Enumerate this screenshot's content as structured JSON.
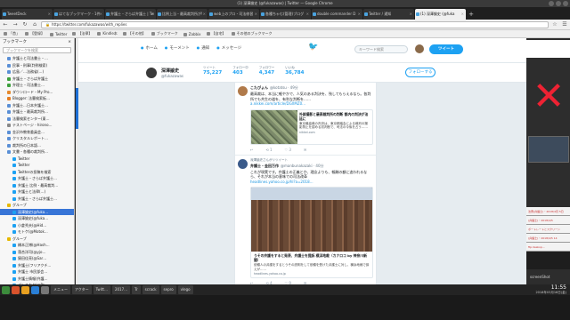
{
  "window": {
    "title": "(1) 深澤諭史 (@fukazawas) | Twitter — Google Chrome"
  },
  "tabs": [
    {
      "label": "TweetDeck",
      "active": false
    },
    {
      "label": "はてなブックマーク - 1件",
      "active": false
    },
    {
      "label": "弁護士・さらば弁護士 | Tw",
      "active": false
    },
    {
      "label": "比例上当・最高裁判所が!",
      "active": false
    },
    {
      "label": "web上のプロ・司法修習",
      "active": false
    },
    {
      "label": "各種ちゃむ(管理)ブログ",
      "active": false
    },
    {
      "label": "double commander D",
      "active": false
    },
    {
      "label": "Twitter / 通知",
      "active": false
    },
    {
      "label": "(1) 深澤諭史 (@fuka",
      "active": true
    }
  ],
  "nav": {
    "url": "https://twitter.com/fukazawas/with_replies",
    "search_placeholder": "検索"
  },
  "bookmarks_bar": [
    "「首」",
    "【登録】",
    "Twitter",
    "【法律】",
    "Kindle本",
    "【その他】",
    "ブックマーク",
    "Zabbix",
    "【自宅】",
    "その他のブックマーク"
  ],
  "sidebar": {
    "title": "ブックマーク",
    "close": "×",
    "search_placeholder": "ブックマークを検索",
    "items": [
      {
        "label": "弁護士と司法書士・…",
        "color": "#5a8fd6",
        "selected": false
      },
      {
        "label": "民事・刑事(判例検索)",
        "color": "#5a8fd6",
        "selected": false
      },
      {
        "label": "広島／…法務省(…)",
        "color": "#5a8fd6",
        "selected": false
      },
      {
        "label": "弁護士・さらば弁護士",
        "color": "#3da03d",
        "selected": false
      },
      {
        "label": "弁理士・司法書士…",
        "color": "#3da03d",
        "selected": false
      },
      {
        "label": "ダウンロード・My Pro…",
        "color": "#e68a2e",
        "selected": false
      },
      {
        "label": "Blogger: 法曹検索板…",
        "color": "#e67e22",
        "selected": false
      },
      {
        "label": "弁護士…日本弁護士…",
        "color": "#5a8fd6",
        "selected": false
      },
      {
        "label": "弁護士・最高裁判所…",
        "color": "#5a8fd6",
        "selected": false
      },
      {
        "label": "法曹検索センター(東…",
        "color": "#5a8fd6",
        "selected": false
      },
      {
        "label": "テストページ - hirono…",
        "color": "#888888",
        "selected": false
      },
      {
        "label": "金沢市教育委員会…",
        "color": "#5a8fd6",
        "selected": false
      },
      {
        "label": "クリスタルレポート…",
        "color": "#5a8fd6",
        "selected": false
      },
      {
        "label": "裁判所の日本語…",
        "color": "#5a8fd6",
        "selected": false
      },
      {
        "label": "文書・各種の裁判所…",
        "color": "#5a8fd6",
        "selected": false
      },
      {
        "label": "Twitter",
        "color": "#1da1f2",
        "selected": false
      },
      {
        "label": "Twitter",
        "color": "#1da1f2",
        "selected": false
      },
      {
        "label": "Twitterの投稿を検索",
        "color": "#1da1f2",
        "selected": false
      },
      {
        "label": "弁護士・さらば弁護士…",
        "color": "#1da1f2",
        "selected": false
      },
      {
        "label": "弁護士 比例・最高裁判…",
        "color": "#1da1f2",
        "selected": false
      },
      {
        "label": "弁護士と法律(…)",
        "color": "#1da1f2",
        "selected": false
      },
      {
        "label": "弁護士・さらば弁護士…",
        "color": "#1da1f2",
        "selected": false
      },
      {
        "label": "グループ",
        "color": "#e6b800",
        "selected": false
      },
      {
        "label": "深澤諭史(@fuka…",
        "color": "#1da1f2",
        "selected": true
      },
      {
        "label": "深澤諭史(@fuka…",
        "color": "#1da1f2",
        "selected": false
      },
      {
        "label": "小倉秀夫(@Hid…",
        "color": "#1da1f2",
        "selected": false
      },
      {
        "label": "モトケ(@Motok…",
        "color": "#1da1f2",
        "selected": false
      },
      {
        "label": "グループ",
        "color": "#e6b800",
        "selected": false
      },
      {
        "label": "橋本正博(@Hash…",
        "color": "#1da1f2",
        "selected": false
      },
      {
        "label": "落合洋司(@yjo…",
        "color": "#1da1f2",
        "selected": false
      },
      {
        "label": "猿田佳亮(@Sar…",
        "color": "#1da1f2",
        "selected": false
      },
      {
        "label": "弁護士(フリアクチ…",
        "color": "#1da1f2",
        "selected": false
      },
      {
        "label": "弁護士 市民部会…",
        "color": "#1da1f2",
        "selected": false
      },
      {
        "label": "弁護士情報(弁護…",
        "color": "#1da1f2",
        "selected": false
      },
      {
        "label": "パレスカタ(@Pa…",
        "color": "#1da1f2",
        "selected": false
      }
    ]
  },
  "twitter_header": {
    "nav_items": [
      "ホーム",
      "モーメント",
      "通知",
      "メッセージ"
    ],
    "search_placeholder": "キーワード検索",
    "tweet_button": "ツイート"
  },
  "profile": {
    "name": "深澤諭史",
    "handle": "@fukazawas",
    "stats": [
      {
        "label": "ツイート",
        "value": "75,227"
      },
      {
        "label": "フォロー中",
        "value": "403"
      },
      {
        "label": "フォロワー",
        "value": "4,347"
      },
      {
        "label": "いいね",
        "value": "36,784"
      }
    ],
    "follow_label": "フォローする"
  },
  "tweets": [
    {
      "retweet_note": "",
      "name": "こたぴょん",
      "handle": "@kotatsu · 49分",
      "text": "最高裁は、本当に軽やかで、人気のある判決を、残してもらえるなら。各判所でも共生の道を、有利な判断を……",
      "link": "a.nikkei.com/article/DGXMZ0…",
      "avatar_color": "#b07a4a",
      "card": {
        "title": "外部撮影と最高裁判所の判断 都内の判決が法廷に",
        "desc": "東京最高裁の判決は、東京都議会による裁判の撮影禁止を認める初判断で、司法の今後を占う……",
        "domain": "nikkei.com"
      },
      "actions": [
        "↩",
        "⟲ 1",
        "♡ 3",
        "✉"
      ]
    },
    {
      "retweet_note": "深澤諭史さんがリツイート",
      "name": "弁護士・金田万作",
      "handle": "@manbunakazaki · 40分",
      "text": "これが現実です。弁護士の正義とか、理念よりも、報酬の額に追われるなら、それが本当の意味での司法改革",
      "link": "headlines.yahoo.co.jp/hl?a=2018…",
      "avatar_color": "#3a5a8a",
      "card": {
        "title": "うその弁護をすると発表、弁護士を提訴 横浜地裁（カナロコ by 神奈川新聞）",
        "desc": "依頼人の弁護をするとうその説明をして依頼を受けた弁護士に対し、横浜地裁で訴えが……",
        "domain": "headlines.yahoo.co.jp"
      },
      "actions": [
        "↩",
        "⟲ 4",
        "♡ 9",
        "✉"
      ]
    }
  ],
  "right_panel": {
    "thumbs": [
      "法曹(弁護士)・2018/4月 5日",
      "(弁護士)・2018/4/5",
      "ポートレートとスクリーン",
      "(弁護士)・2018/4/5 14",
      "ftp:deskop..."
    ],
    "label": "screenShot"
  },
  "taskbar": {
    "items": [
      "メニュー",
      "アクター",
      "",
      "Twitt…",
      "2017…",
      "Tr",
      "scrack",
      "sepro",
      "vlego"
    ],
    "time": "11:55",
    "date": "2018年03月16日(金)"
  }
}
